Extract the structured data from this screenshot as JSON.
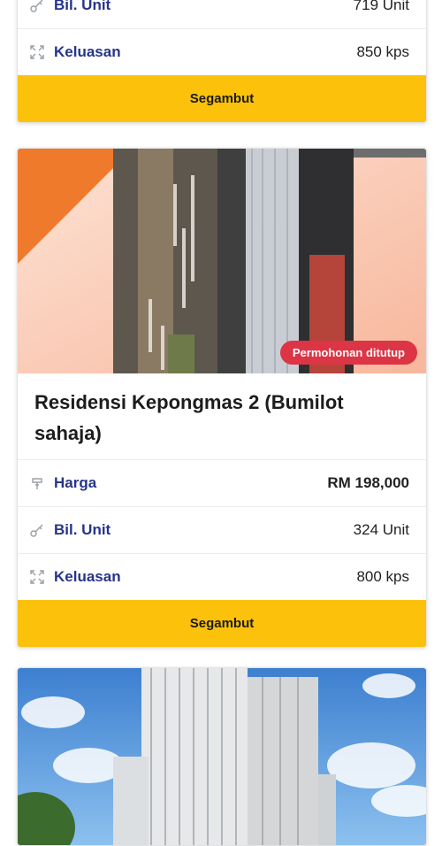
{
  "cards": [
    {
      "rows": [
        {
          "label": "Bil. Unit",
          "value": "719 Unit"
        },
        {
          "label": "Keluasan",
          "value": "850 kps"
        }
      ],
      "button": "Segambut"
    },
    {
      "badge": "Permohonan ditutup",
      "title": "Residensi Kepongmas 2 (Bumilot sahaja)",
      "rows": [
        {
          "label": "Harga",
          "value": "RM 198,000"
        },
        {
          "label": "Bil. Unit",
          "value": "324 Unit"
        },
        {
          "label": "Keluasan",
          "value": "800 kps"
        }
      ],
      "button": "Segambut"
    }
  ],
  "colors": {
    "accent": "#fbc10b",
    "label": "#26348b",
    "badge": "#dc3545"
  },
  "icons": {
    "units": "key-icon",
    "area": "expand-icon",
    "price": "price-tag-icon"
  }
}
